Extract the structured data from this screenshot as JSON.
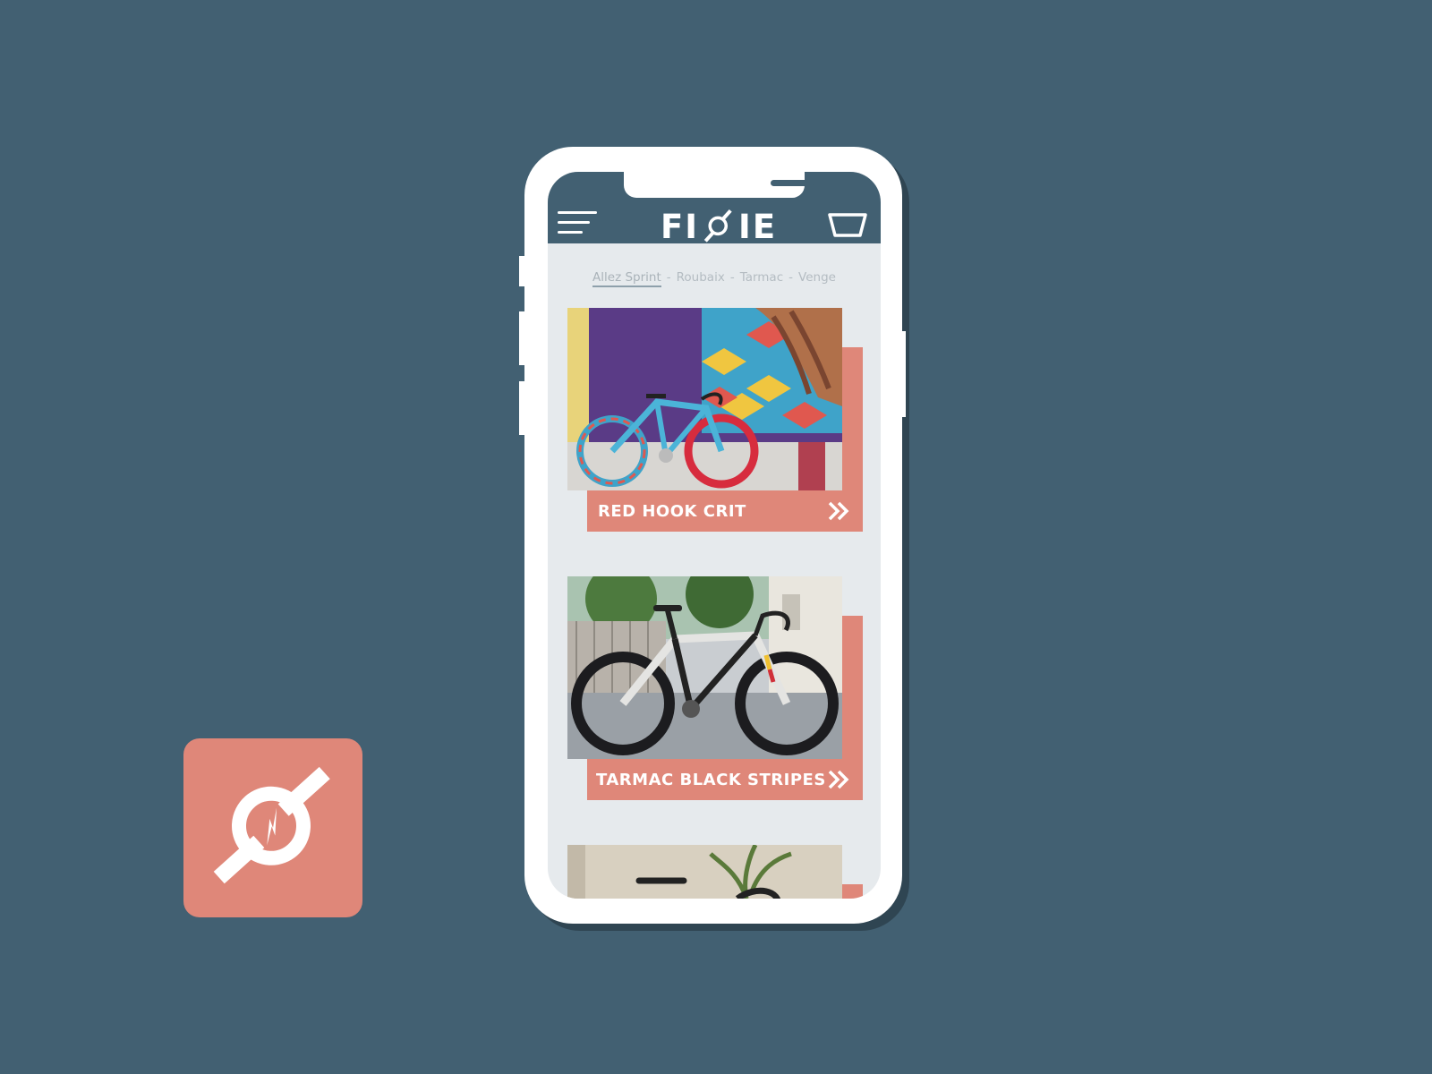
{
  "app": {
    "logo_text_left": "FI",
    "logo_text_right": "IE"
  },
  "tabs": [
    {
      "label": "Allez Sprint",
      "active": true
    },
    {
      "label": "Roubaix",
      "active": false
    },
    {
      "label": "Tarmac",
      "active": false
    },
    {
      "label": "Venge",
      "active": false
    }
  ],
  "tab_separator": "-",
  "cards": [
    {
      "title": "RED HOOK CRIT"
    },
    {
      "title": "TARMAC BLACK STRIPES"
    }
  ],
  "colors": {
    "background": "#426072",
    "accent": "#df8779",
    "screen": "#e6eaed"
  },
  "icons": [
    "hamburger-menu-icon",
    "cart-icon",
    "double-chevron-right-icon",
    "app-logo-icon"
  ]
}
